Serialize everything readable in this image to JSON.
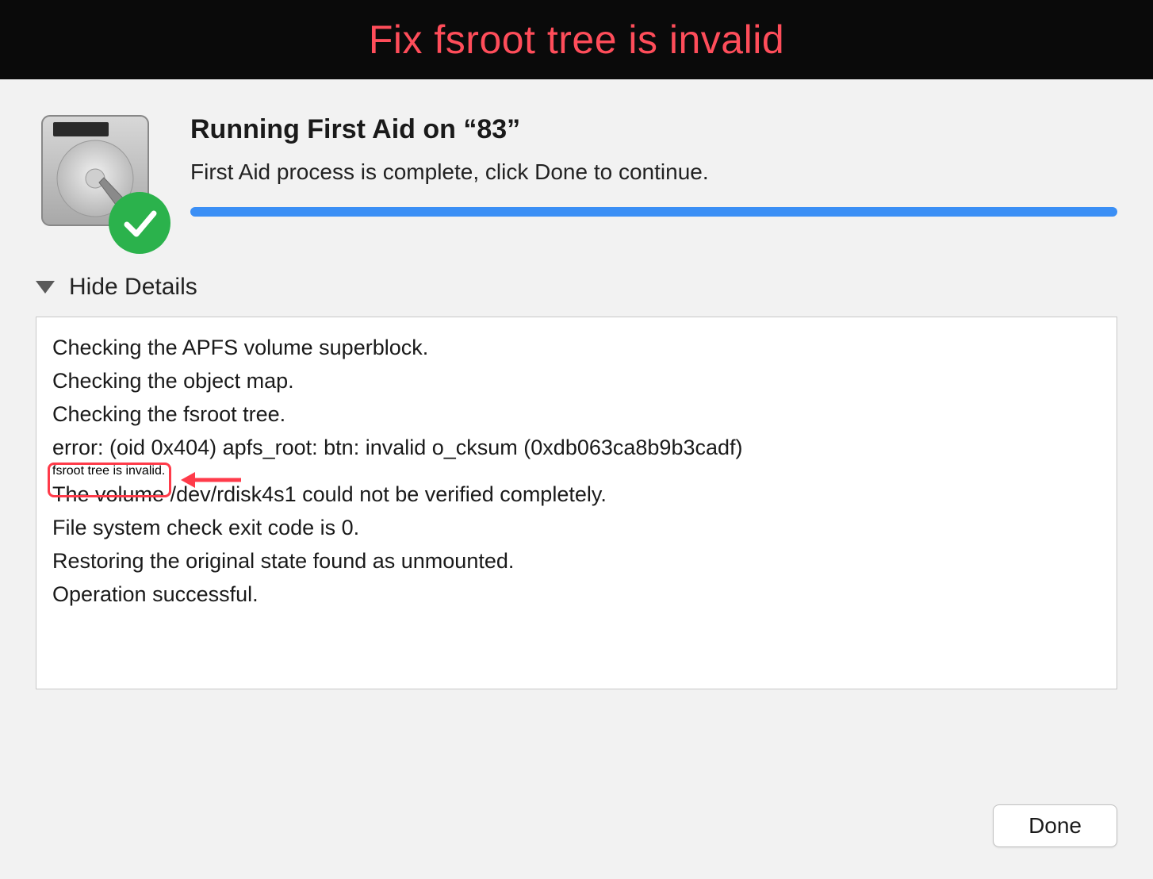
{
  "banner": {
    "title": "Fix fsroot tree is invalid"
  },
  "dialog": {
    "title": "Running First Aid on “83”",
    "subtitle": "First Aid process is complete, click Done to continue.",
    "toggle_label": "Hide Details",
    "done_label": "Done"
  },
  "log": {
    "lines": [
      "Checking the APFS volume superblock.",
      "Checking the object map.",
      "Checking the fsroot tree.",
      "error: (oid 0x404) apfs_root: btn: invalid o_cksum (0xdb063ca8b9b3cadf)",
      "fsroot tree is invalid.",
      "The volume /dev/rdisk4s1 could not be verified completely.",
      "File system check exit code is 0.",
      "Restoring the original state found as unmounted.",
      "Operation successful."
    ],
    "highlight_index": 4
  },
  "colors": {
    "banner_bg": "#0a0a0a",
    "banner_text": "#ff4d5a",
    "progress": "#3b8ff5",
    "highlight": "#ff3b4a",
    "check_badge": "#2bb24c"
  }
}
